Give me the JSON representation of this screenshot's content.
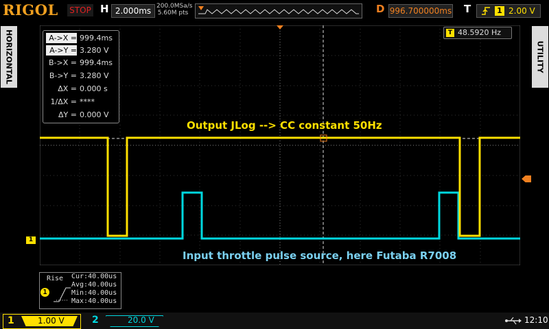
{
  "header": {
    "brand": "RIGOL",
    "run_state": "STOP",
    "horizontal_label": "H",
    "timebase": "2.000ms",
    "sample_rate": "200.0MSa/s",
    "memory_depth": "5.60M pts",
    "delay_label": "D",
    "delay": "996.700000ms",
    "trigger_label": "T",
    "trigger_source": "1",
    "trigger_level": "2.00 V"
  },
  "side": {
    "left_tab": "HORIZONTAL",
    "right_tab": "UTILITY"
  },
  "cursor_measurements": [
    {
      "key": "A->X =",
      "value": "999.4ms",
      "highlight": true
    },
    {
      "key": "A->Y =",
      "value": "3.280 V",
      "highlight": true
    },
    {
      "key": "B->X =",
      "value": "999.4ms",
      "highlight": false
    },
    {
      "key": "B->Y =",
      "value": "3.280 V",
      "highlight": false
    },
    {
      "key": "ΔX =",
      "value": "0.000 s",
      "highlight": false
    },
    {
      "key": "1/ΔX =",
      "value": "****",
      "highlight": false
    },
    {
      "key": "ΔY =",
      "value": "0.000 V",
      "highlight": false
    }
  ],
  "frequency_readout": {
    "value": "48.5920 Hz",
    "icon": "T"
  },
  "annotations": {
    "top": "Output JLog --> CC   constant 50Hz",
    "bottom": "Input throttle pulse source, here Futaba R7008"
  },
  "trigger_panel": {
    "mode": "Rise",
    "channel": "1",
    "cur": "Cur:40.00us",
    "avg": "Avg:40.00us",
    "min": "Min:40.00us",
    "max": "Max:40.00us"
  },
  "channels": [
    {
      "num": "1",
      "scale": "1.00 V",
      "color": "#ffe000"
    },
    {
      "num": "2",
      "scale": "20.0 V",
      "color": "#00d8e0"
    }
  ],
  "ground_marker": "1",
  "clock": "12:10",
  "colors": {
    "ch1": "#ffe000",
    "ch2": "#00d8e0",
    "trigger": "#f08020",
    "brand": "#f0a020"
  }
}
